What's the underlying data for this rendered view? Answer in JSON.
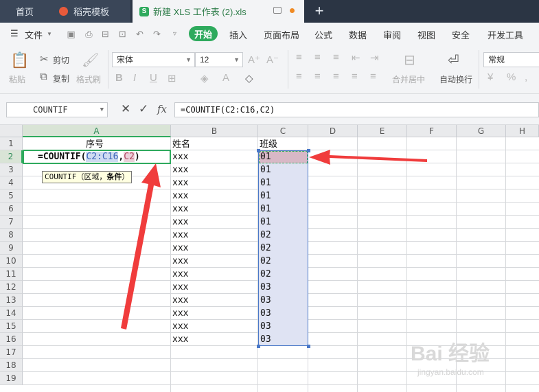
{
  "tabs": {
    "home": "首页",
    "template": "稻壳模板",
    "document": "新建 XLS 工作表 (2).xls",
    "new_tab": "+"
  },
  "menu": {
    "file": "文件",
    "items": [
      "开始",
      "插入",
      "页面布局",
      "公式",
      "数据",
      "审阅",
      "视图",
      "安全",
      "开发工具"
    ]
  },
  "ribbon": {
    "paste": "粘贴",
    "cut": "剪切",
    "copy": "复制",
    "format_painter": "格式刷",
    "font_name": "宋体",
    "font_size": "12",
    "merge_center": "合并居中",
    "wrap_text": "自动换行",
    "number_format": "常规"
  },
  "formula_bar": {
    "name_box": "COUNTIF",
    "fx": "fx",
    "formula": "=COUNTIF(C2:C16,C2)"
  },
  "grid": {
    "columns": [
      "A",
      "B",
      "C",
      "D",
      "E",
      "F",
      "G",
      "H"
    ],
    "rows": [
      "1",
      "2",
      "3",
      "4",
      "5",
      "6",
      "7",
      "8",
      "9",
      "10",
      "11",
      "12",
      "13",
      "14",
      "15",
      "16",
      "17",
      "18",
      "19"
    ],
    "header_a": "序号",
    "header_b": "姓名",
    "header_c": "班级",
    "names": [
      "xxx",
      "xxx",
      "xxx",
      "xxx",
      "xxx",
      "xxx",
      "xxx",
      "xxx",
      "xxx",
      "xxx",
      "xxx",
      "xxx",
      "xxx",
      "xxx",
      "xxx"
    ],
    "classes": [
      "01",
      "01",
      "01",
      "01",
      "01",
      "01",
      "02",
      "02",
      "02",
      "02",
      "03",
      "03",
      "03",
      "03",
      "03"
    ],
    "editing": {
      "prefix": "=COUNTIF(",
      "ref_range": "C2:C16",
      "comma": ",",
      "ref_cell": "C2",
      "suffix": ")"
    },
    "tooltip": {
      "func": "COUNTIF（区域，",
      "arg": "条件",
      "close": "）"
    }
  },
  "watermark": {
    "brand": "Bai 经验",
    "url": "jingyan.baidu.com"
  },
  "colors": {
    "accent": "#2eaa5d",
    "range_border": "#4a78c8",
    "arrow": "#f03c3c"
  }
}
